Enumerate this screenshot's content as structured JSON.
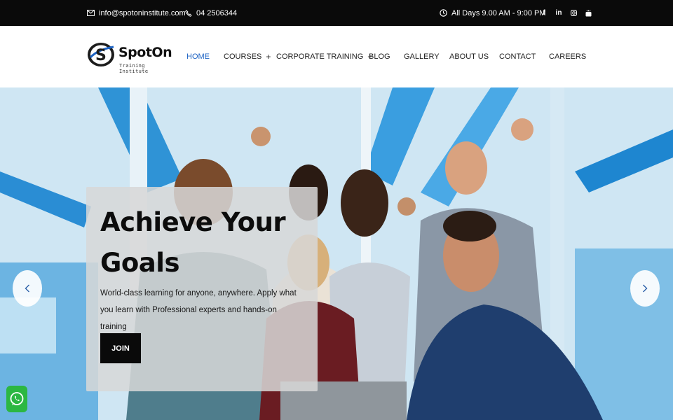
{
  "topbar": {
    "email": "info@spotoninstitute.com",
    "phone": "04 2506344",
    "hours": "All Days 9.00 AM - 9:00 PM",
    "social": [
      {
        "icon": "facebook-icon",
        "glyph": "f"
      },
      {
        "icon": "linkedin-icon",
        "glyph": "in"
      },
      {
        "icon": "instagram-icon",
        "glyph": ""
      },
      {
        "icon": "youtube-icon",
        "glyph": ""
      }
    ]
  },
  "logo": {
    "name": "SpotOn",
    "tagline": "Training Institute"
  },
  "nav": {
    "home": "HOME",
    "courses": "COURSES",
    "corporate": "CORPORATE TRAINING",
    "blog": "BLOG",
    "gallery": "GALLERY",
    "about": "ABOUT US",
    "contact": "CONTACT",
    "careers": "CAREERS",
    "plus": "+"
  },
  "hero": {
    "title": "Achieve Your Goals",
    "subtitle": "World-class learning for anyone, anywhere. Apply what you learn with Professional experts and hands-on training",
    "cta": "JOIN",
    "prev": "‹",
    "next": "›"
  },
  "colors": {
    "accent": "#1d63c4",
    "topbar": "#0a0a0a",
    "whatsapp": "#2cb742"
  }
}
